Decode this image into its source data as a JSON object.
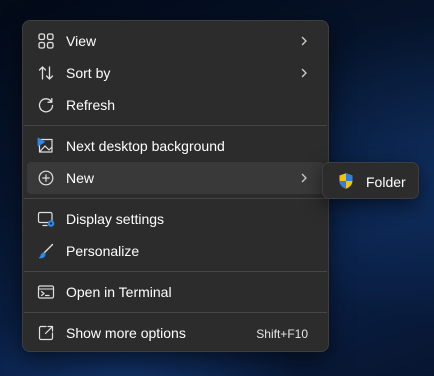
{
  "context_menu": {
    "items": [
      {
        "label": "View",
        "icon": "view-grid-icon"
      },
      {
        "label": "Sort by",
        "icon": "sort-icon"
      },
      {
        "label": "Refresh",
        "icon": "refresh-icon"
      },
      {
        "label": "Next desktop background",
        "icon": "next-background-icon"
      },
      {
        "label": "New",
        "icon": "new-plus-circle-icon"
      },
      {
        "label": "Display settings",
        "icon": "display-settings-icon"
      },
      {
        "label": "Personalize",
        "icon": "personalize-brush-icon"
      },
      {
        "label": "Open in Terminal",
        "icon": "terminal-icon"
      },
      {
        "label": "Show more options",
        "icon": "show-more-options-icon",
        "shortcut": "Shift+F10"
      }
    ]
  },
  "submenu": {
    "items": [
      {
        "label": "Folder",
        "icon": "uac-shield-icon"
      }
    ]
  },
  "colors": {
    "menu_background": "#2c2c2c",
    "hover_background": "#393939",
    "accent_blue": "#2f88e6",
    "shield_yellow": "#f4c20d"
  }
}
